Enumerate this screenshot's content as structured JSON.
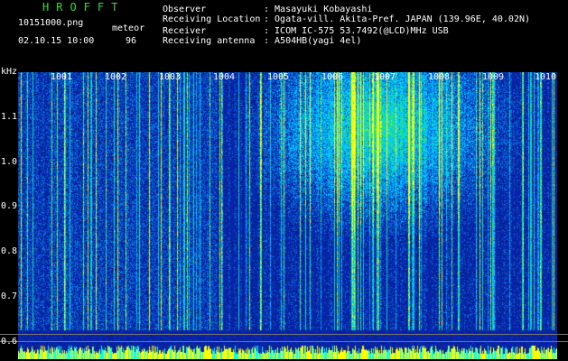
{
  "header": {
    "brand": "HROFFT",
    "filename": "10151000.png",
    "timestamp": "02.10.15 10:00",
    "meteor_label": "meteor",
    "meteor_count": "96",
    "info": [
      {
        "key": "Observer",
        "value": ": Masayuki Kobayashi"
      },
      {
        "key": "Receiving Location",
        "value": ": Ogata-vill. Akita-Pref. JAPAN (139.96E, 40.02N)"
      },
      {
        "key": "Receiver",
        "value": ": ICOM IC-575 53.7492(@LCD)MHz USB"
      },
      {
        "key": "Receiving antenna",
        "value": ": A504HB(yagi 4el)"
      }
    ]
  },
  "spectrogram": {
    "y_unit": "kHz",
    "minute_labels": [
      "1001",
      "1002",
      "1003",
      "1004",
      "1005",
      "1006",
      "1007",
      "1008",
      "1009",
      "1010"
    ],
    "y_ticks": [
      "1.1",
      "1.0",
      "0.9",
      "0.8",
      "0.7",
      "0.6"
    ],
    "colors": {
      "background": "#0a1d9a",
      "signal": "#00e0ff",
      "strong": "#ffff00"
    }
  }
}
